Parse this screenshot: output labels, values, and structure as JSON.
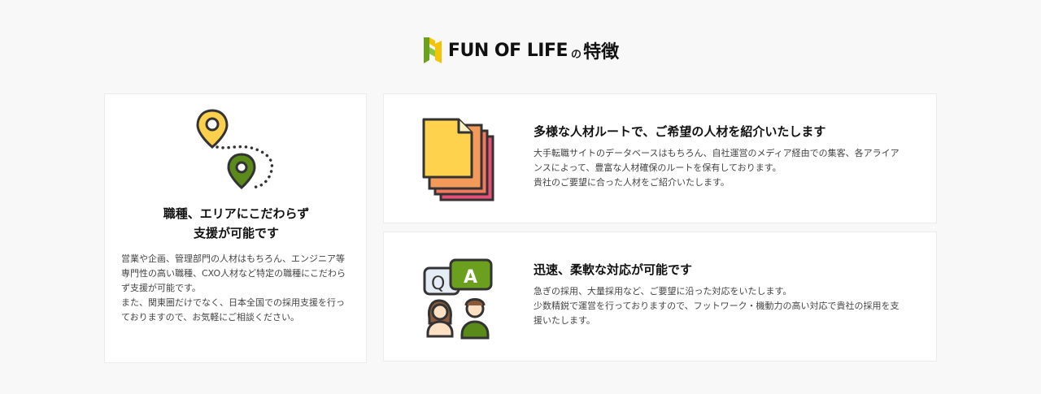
{
  "header": {
    "brand": "FUN OF LIFE",
    "connector": "の",
    "suffix": "特徴"
  },
  "features": {
    "left": {
      "title_line1": "職種、エリアにこだわらず",
      "title_line2": "支援が可能です",
      "desc_para1": "営業や企画、管理部門の人材はもちろん、エンジニア等専門性の高い職種、CXO人材など特定の職種にこだわらず支援が可能です。",
      "desc_para2": "また、関東圏だけでなく、日本全国での採用支援を行っておりますので、お気軽にご相談ください。"
    },
    "routes": {
      "title": "多様な人材ルートで、ご希望の人材を紹介いたします",
      "desc_para1": "大手転職サイトのデータベースはもちろん、自社運営のメディア経由での集客、各アライアンスによって、豊富な人材確保のルートを保有しております。",
      "desc_para2": "貴社のご要望に合った人材をご紹介いたします。"
    },
    "speed": {
      "title": "迅速、柔軟な対応が可能です",
      "desc_para1": "急ぎの採用、大量採用など、ご要望に沿った対応をいたします。",
      "desc_para2": "少数精鋭で運営を行っておりますので、フットワーク・機動力の高い対応で貴社の採用を支援いたします。"
    }
  },
  "icons": {
    "logo": "fun-of-life-logo-icon",
    "map_route": "map-route-icon",
    "documents": "document-stack-icon",
    "qa": "qa-chat-icon"
  },
  "colors": {
    "background": "#f8f8f8",
    "card": "#ffffff",
    "logo_yellow": "#f5c400",
    "logo_green": "#6aa01e",
    "pin_yellow": "#fccf4d",
    "pin_green": "#5a8a1a",
    "doc_yellow": "#ffd24d",
    "doc_orange": "#f39a5a",
    "doc_pink": "#e8507a",
    "bubble_green": "#6aa01e"
  }
}
